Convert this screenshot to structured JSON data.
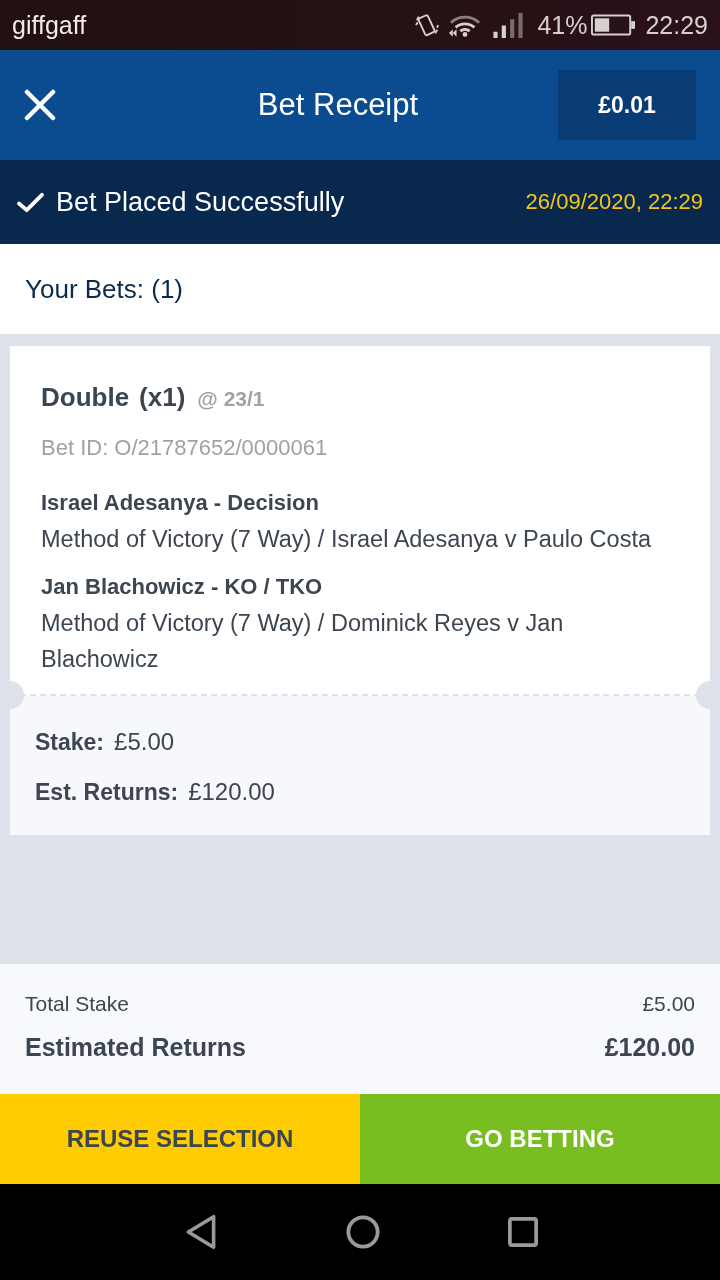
{
  "status_bar": {
    "carrier": "giffgaff",
    "battery_text": "41%",
    "time": "22:29"
  },
  "header": {
    "title": "Bet Receipt",
    "balance": "£0.01"
  },
  "banner": {
    "message": "Bet Placed Successfully",
    "datetime": "26/09/2020, 22:29"
  },
  "bets_heading": "Your Bets: (1)",
  "bet": {
    "type": "Double",
    "multiplier": "(x1)",
    "odds": "@ 23/1",
    "bet_id": "Bet ID: O/21787652/0000061",
    "selections": [
      {
        "name": "Israel Adesanya - Decision",
        "market": "Method of Victory (7 Way) / Israel Adesanya v Paulo Costa"
      },
      {
        "name": "Jan Blachowicz - KO / TKO",
        "market": "Method of Victory (7 Way) / Dominick Reyes v Jan Blachowicz"
      }
    ],
    "stake_label": "Stake:",
    "stake": "£5.00",
    "returns_label": "Est. Returns:",
    "returns": "£120.00"
  },
  "summary": [
    {
      "kind": "plain",
      "label": "Total Stake",
      "value": "£5.00"
    },
    {
      "kind": "strong",
      "label": "Estimated Returns",
      "value": "£120.00"
    }
  ],
  "actions": [
    {
      "kind": "secondary",
      "label": "REUSE SELECTION"
    },
    {
      "kind": "primary",
      "label": "GO BETTING"
    }
  ]
}
